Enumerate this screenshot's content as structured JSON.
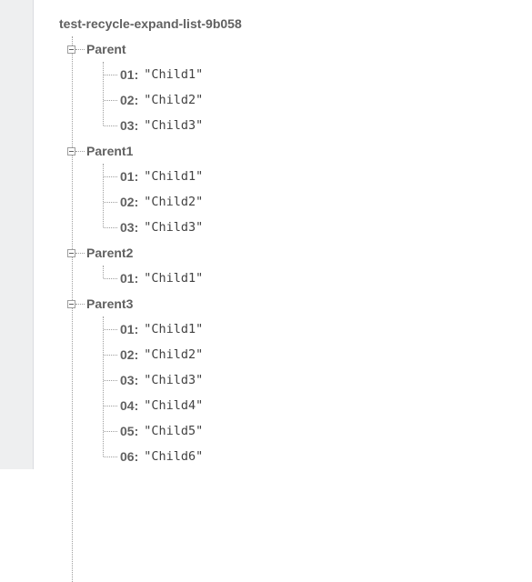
{
  "root": {
    "label": "test-recycle-expand-list-9b058"
  },
  "parents": [
    {
      "label": "Parent",
      "children": [
        {
          "key": "01:",
          "value": "\"Child1\""
        },
        {
          "key": "02:",
          "value": "\"Child2\""
        },
        {
          "key": "03:",
          "value": "\"Child3\""
        }
      ]
    },
    {
      "label": "Parent1",
      "children": [
        {
          "key": "01:",
          "value": "\"Child1\""
        },
        {
          "key": "02:",
          "value": "\"Child2\""
        },
        {
          "key": "03:",
          "value": "\"Child3\""
        }
      ]
    },
    {
      "label": "Parent2",
      "children": [
        {
          "key": "01:",
          "value": "\"Child1\""
        }
      ]
    },
    {
      "label": "Parent3",
      "children": [
        {
          "key": "01:",
          "value": "\"Child1\""
        },
        {
          "key": "02:",
          "value": "\"Child2\""
        },
        {
          "key": "03:",
          "value": "\"Child3\""
        },
        {
          "key": "04:",
          "value": "\"Child4\""
        },
        {
          "key": "05:",
          "value": "\"Child5\""
        },
        {
          "key": "06:",
          "value": "\"Child6\""
        }
      ]
    }
  ],
  "icons": {
    "collapse": "minus-square-icon"
  },
  "colors": {
    "text": "#616161",
    "value": "#424242",
    "line": "#9e9e9e",
    "gutter": "#eeeff0"
  }
}
